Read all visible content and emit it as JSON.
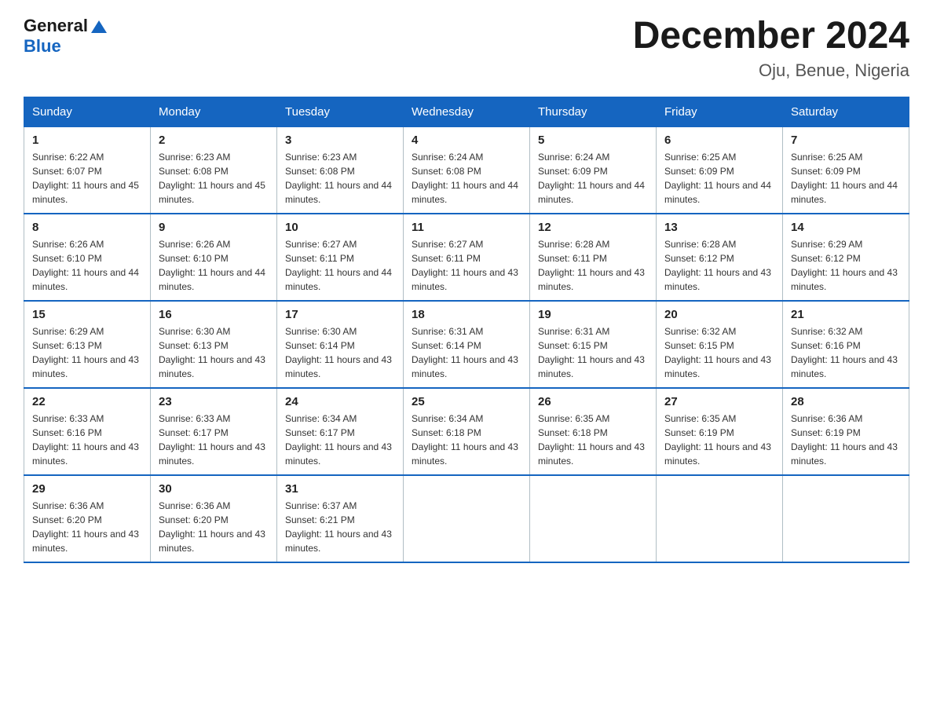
{
  "header": {
    "title": "December 2024",
    "location": "Oju, Benue, Nigeria",
    "logo_general": "General",
    "logo_blue": "Blue"
  },
  "days_of_week": [
    "Sunday",
    "Monday",
    "Tuesday",
    "Wednesday",
    "Thursday",
    "Friday",
    "Saturday"
  ],
  "weeks": [
    [
      {
        "day": "1",
        "sunrise": "Sunrise: 6:22 AM",
        "sunset": "Sunset: 6:07 PM",
        "daylight": "Daylight: 11 hours and 45 minutes."
      },
      {
        "day": "2",
        "sunrise": "Sunrise: 6:23 AM",
        "sunset": "Sunset: 6:08 PM",
        "daylight": "Daylight: 11 hours and 45 minutes."
      },
      {
        "day": "3",
        "sunrise": "Sunrise: 6:23 AM",
        "sunset": "Sunset: 6:08 PM",
        "daylight": "Daylight: 11 hours and 44 minutes."
      },
      {
        "day": "4",
        "sunrise": "Sunrise: 6:24 AM",
        "sunset": "Sunset: 6:08 PM",
        "daylight": "Daylight: 11 hours and 44 minutes."
      },
      {
        "day": "5",
        "sunrise": "Sunrise: 6:24 AM",
        "sunset": "Sunset: 6:09 PM",
        "daylight": "Daylight: 11 hours and 44 minutes."
      },
      {
        "day": "6",
        "sunrise": "Sunrise: 6:25 AM",
        "sunset": "Sunset: 6:09 PM",
        "daylight": "Daylight: 11 hours and 44 minutes."
      },
      {
        "day": "7",
        "sunrise": "Sunrise: 6:25 AM",
        "sunset": "Sunset: 6:09 PM",
        "daylight": "Daylight: 11 hours and 44 minutes."
      }
    ],
    [
      {
        "day": "8",
        "sunrise": "Sunrise: 6:26 AM",
        "sunset": "Sunset: 6:10 PM",
        "daylight": "Daylight: 11 hours and 44 minutes."
      },
      {
        "day": "9",
        "sunrise": "Sunrise: 6:26 AM",
        "sunset": "Sunset: 6:10 PM",
        "daylight": "Daylight: 11 hours and 44 minutes."
      },
      {
        "day": "10",
        "sunrise": "Sunrise: 6:27 AM",
        "sunset": "Sunset: 6:11 PM",
        "daylight": "Daylight: 11 hours and 44 minutes."
      },
      {
        "day": "11",
        "sunrise": "Sunrise: 6:27 AM",
        "sunset": "Sunset: 6:11 PM",
        "daylight": "Daylight: 11 hours and 43 minutes."
      },
      {
        "day": "12",
        "sunrise": "Sunrise: 6:28 AM",
        "sunset": "Sunset: 6:11 PM",
        "daylight": "Daylight: 11 hours and 43 minutes."
      },
      {
        "day": "13",
        "sunrise": "Sunrise: 6:28 AM",
        "sunset": "Sunset: 6:12 PM",
        "daylight": "Daylight: 11 hours and 43 minutes."
      },
      {
        "day": "14",
        "sunrise": "Sunrise: 6:29 AM",
        "sunset": "Sunset: 6:12 PM",
        "daylight": "Daylight: 11 hours and 43 minutes."
      }
    ],
    [
      {
        "day": "15",
        "sunrise": "Sunrise: 6:29 AM",
        "sunset": "Sunset: 6:13 PM",
        "daylight": "Daylight: 11 hours and 43 minutes."
      },
      {
        "day": "16",
        "sunrise": "Sunrise: 6:30 AM",
        "sunset": "Sunset: 6:13 PM",
        "daylight": "Daylight: 11 hours and 43 minutes."
      },
      {
        "day": "17",
        "sunrise": "Sunrise: 6:30 AM",
        "sunset": "Sunset: 6:14 PM",
        "daylight": "Daylight: 11 hours and 43 minutes."
      },
      {
        "day": "18",
        "sunrise": "Sunrise: 6:31 AM",
        "sunset": "Sunset: 6:14 PM",
        "daylight": "Daylight: 11 hours and 43 minutes."
      },
      {
        "day": "19",
        "sunrise": "Sunrise: 6:31 AM",
        "sunset": "Sunset: 6:15 PM",
        "daylight": "Daylight: 11 hours and 43 minutes."
      },
      {
        "day": "20",
        "sunrise": "Sunrise: 6:32 AM",
        "sunset": "Sunset: 6:15 PM",
        "daylight": "Daylight: 11 hours and 43 minutes."
      },
      {
        "day": "21",
        "sunrise": "Sunrise: 6:32 AM",
        "sunset": "Sunset: 6:16 PM",
        "daylight": "Daylight: 11 hours and 43 minutes."
      }
    ],
    [
      {
        "day": "22",
        "sunrise": "Sunrise: 6:33 AM",
        "sunset": "Sunset: 6:16 PM",
        "daylight": "Daylight: 11 hours and 43 minutes."
      },
      {
        "day": "23",
        "sunrise": "Sunrise: 6:33 AM",
        "sunset": "Sunset: 6:17 PM",
        "daylight": "Daylight: 11 hours and 43 minutes."
      },
      {
        "day": "24",
        "sunrise": "Sunrise: 6:34 AM",
        "sunset": "Sunset: 6:17 PM",
        "daylight": "Daylight: 11 hours and 43 minutes."
      },
      {
        "day": "25",
        "sunrise": "Sunrise: 6:34 AM",
        "sunset": "Sunset: 6:18 PM",
        "daylight": "Daylight: 11 hours and 43 minutes."
      },
      {
        "day": "26",
        "sunrise": "Sunrise: 6:35 AM",
        "sunset": "Sunset: 6:18 PM",
        "daylight": "Daylight: 11 hours and 43 minutes."
      },
      {
        "day": "27",
        "sunrise": "Sunrise: 6:35 AM",
        "sunset": "Sunset: 6:19 PM",
        "daylight": "Daylight: 11 hours and 43 minutes."
      },
      {
        "day": "28",
        "sunrise": "Sunrise: 6:36 AM",
        "sunset": "Sunset: 6:19 PM",
        "daylight": "Daylight: 11 hours and 43 minutes."
      }
    ],
    [
      {
        "day": "29",
        "sunrise": "Sunrise: 6:36 AM",
        "sunset": "Sunset: 6:20 PM",
        "daylight": "Daylight: 11 hours and 43 minutes."
      },
      {
        "day": "30",
        "sunrise": "Sunrise: 6:36 AM",
        "sunset": "Sunset: 6:20 PM",
        "daylight": "Daylight: 11 hours and 43 minutes."
      },
      {
        "day": "31",
        "sunrise": "Sunrise: 6:37 AM",
        "sunset": "Sunset: 6:21 PM",
        "daylight": "Daylight: 11 hours and 43 minutes."
      },
      {
        "day": "",
        "sunrise": "",
        "sunset": "",
        "daylight": ""
      },
      {
        "day": "",
        "sunrise": "",
        "sunset": "",
        "daylight": ""
      },
      {
        "day": "",
        "sunrise": "",
        "sunset": "",
        "daylight": ""
      },
      {
        "day": "",
        "sunrise": "",
        "sunset": "",
        "daylight": ""
      }
    ]
  ]
}
